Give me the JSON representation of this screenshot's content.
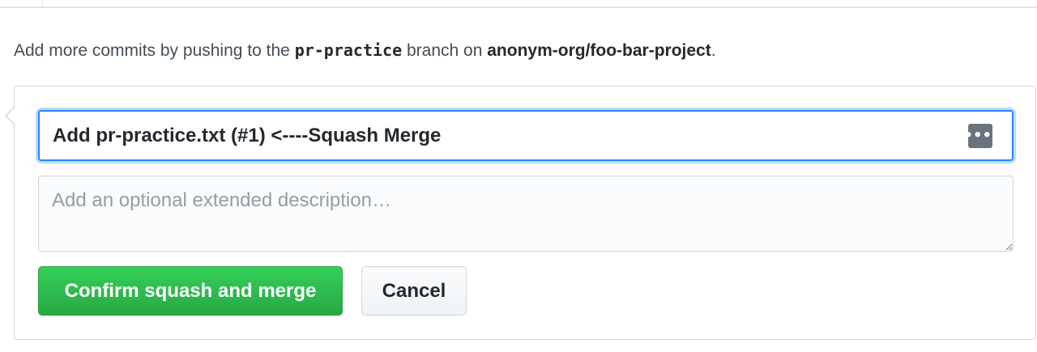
{
  "info": {
    "prefix": "Add more commits by pushing to the",
    "branch": "pr-practice",
    "middle": "branch on",
    "repo": "anonym-org/foo-bar-project",
    "suffix": "."
  },
  "merge_form": {
    "commit_title": "Add pr-practice.txt (#1) <----Squash Merge",
    "ellipsis_icon": "•••|",
    "description_placeholder": "Add an optional extended description…",
    "confirm_label": "Confirm squash and merge",
    "cancel_label": "Cancel"
  },
  "colors": {
    "accent_blue": "#2188ff",
    "merge_green": "#28a745",
    "border": "#d1d5da"
  }
}
